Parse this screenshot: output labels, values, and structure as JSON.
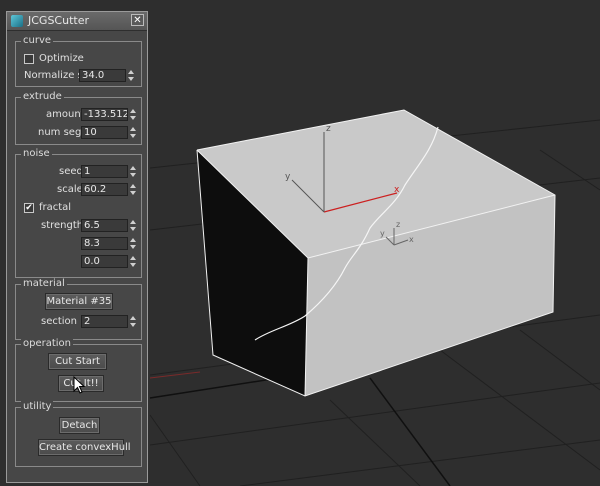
{
  "window": {
    "title": "JCGSCutter",
    "close_label": "✕",
    "icon": "app-icon"
  },
  "curve": {
    "title": "curve",
    "optimize": {
      "label": "Optimize",
      "checked": false
    },
    "normalize": {
      "label": "Normalize spl",
      "value": "34.0"
    }
  },
  "extrude": {
    "title": "extrude",
    "amount": {
      "label": "amount",
      "value": "-133.512"
    },
    "num_segs": {
      "label": "num segs",
      "value": "10"
    }
  },
  "noise": {
    "title": "noise",
    "seed": {
      "label": "seed",
      "value": "1"
    },
    "scale": {
      "label": "scale",
      "value": "60.2"
    },
    "fractal": {
      "label": "fractal",
      "checked": true,
      "check_mark": "✔"
    },
    "strength": {
      "label": "strength",
      "values": [
        "6.5",
        "8.3",
        "0.0"
      ]
    }
  },
  "material": {
    "title": "material",
    "button_label": "Material #35",
    "section_id": {
      "label": "section id",
      "value": "2"
    }
  },
  "operation": {
    "title": "operation",
    "cut_start_label": "Cut Start",
    "cut_it_label": "Cut It!!"
  },
  "utility": {
    "title": "utility",
    "detach_label": "Detach",
    "convex_hull_label": "Create convexHull"
  },
  "viewport": {
    "pivot_main": {
      "x_label": "x",
      "y_label": "y",
      "z_label": "z"
    },
    "pivot_small": {
      "x_label": "x",
      "y_label": "y",
      "z_label": "z"
    }
  }
}
